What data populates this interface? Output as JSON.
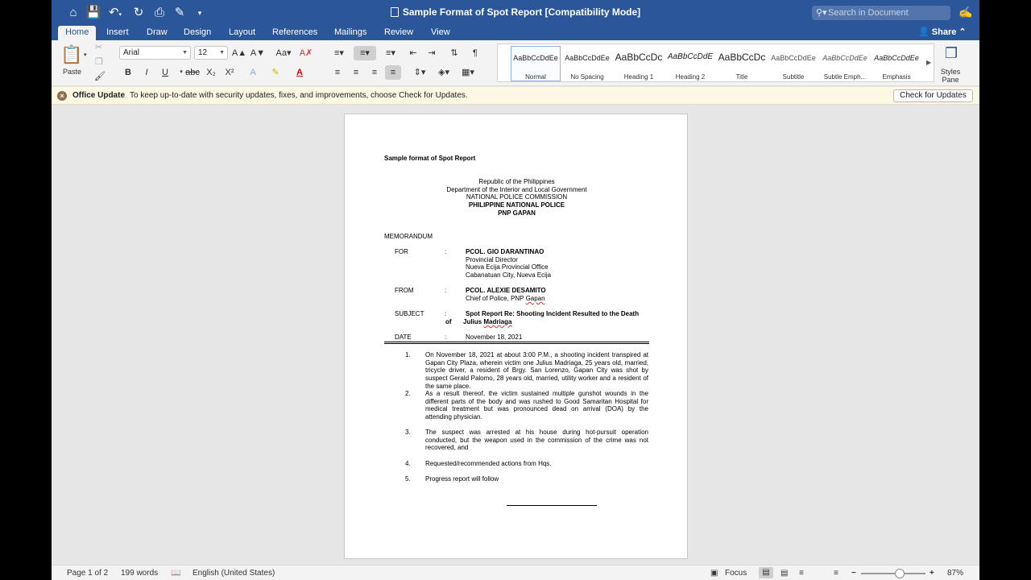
{
  "window": {
    "title": "Sample Format of Spot Report [Compatibility Mode]",
    "search_placeholder": "Search in Document"
  },
  "quick_access": {
    "home_icon": "home-icon",
    "save_icon": "save-icon",
    "undo_icon": "undo-icon",
    "redo_icon": "redo-icon",
    "print_icon": "print-icon"
  },
  "tabs": [
    "Home",
    "Insert",
    "Draw",
    "Design",
    "Layout",
    "References",
    "Mailings",
    "Review",
    "View"
  ],
  "active_tab": "Home",
  "share_label": "Share",
  "ribbon": {
    "paste_label": "Paste",
    "font_name": "Arial",
    "font_size": "12",
    "styles": [
      {
        "preview": "AaBbCcDdEe",
        "name": "Normal"
      },
      {
        "preview": "AaBbCcDdEe",
        "name": "No Spacing"
      },
      {
        "preview": "AaBbCcDc",
        "name": "Heading 1"
      },
      {
        "preview": "AaBbCcDdE",
        "name": "Heading 2"
      },
      {
        "preview": "AaBbCcDc",
        "name": "Title"
      },
      {
        "preview": "AaBbCcDdEe",
        "name": "Subtitle"
      },
      {
        "preview": "AaBbCcDdEe",
        "name": "Subtle Emph..."
      },
      {
        "preview": "AaBbCcDdEe",
        "name": "Emphasis"
      }
    ],
    "styles_pane_label": "Styles Pane"
  },
  "update_bar": {
    "title": "Office Update",
    "message": "To keep up-to-date with security updates, fixes, and improvements, choose Check for Updates.",
    "button": "Check for Updates"
  },
  "document": {
    "heading": "Sample format of Spot Report",
    "letterhead": [
      "Republic of the Philippines",
      "Department of the Interior and Local Government",
      "NATIONAL POLICE COMMISSION",
      "PHILIPPINE NATIONAL POLICE",
      "PNP GAPAN"
    ],
    "memo_label": "MEMORANDUM",
    "for_label": "FOR",
    "for_lines": [
      "PCOL. GIO DARANTINAO",
      "Provincial Director",
      "Nueva Ecija Provincial Office",
      "Cabanatuan City, Nueva Ecija"
    ],
    "from_label": "FROM",
    "from_lines": [
      "PCOL. ALEXIE DESAMITO",
      "Chief of Police, PNP "
    ],
    "from_gapan": "Gapan",
    "subject_label": "SUBJECT",
    "subject_line1": "Spot Report Re: Shooting Incident Resulted to the Death",
    "subject_of": "of",
    "subject_line2a": "Julius ",
    "subject_madriaga": "Madriaga",
    "date_label": "DATE",
    "date_value": "November 18, 2021",
    "colon": ":",
    "items": [
      {
        "num": "1.",
        "text": "On November 18, 2021 at about 3:00 P.M., a shooting incident transpired at Gapan City Plaza, wherein victim one Julius Madriaga, 25 years old, married, tricycle driver, a resident of Brgy. San Lorenzo, Gapan City was shot by suspect Gerald Palomo, 28 years old, married, utility worker and a resident of the same place."
      },
      {
        "num": "2.",
        "text": "As a result thereof, the victim sustained multiple gunshot wounds in the different parts of the body and was rushed to Good Samaritan Hospital for medical treatment but was pronounced dead on arrival (DOA) by the attending physician."
      },
      {
        "num": "3.",
        "text": "The suspect was arrested at his house during hot-pursuit operation conducted, but the weapon used in the commission of the crime was not recovered, and"
      },
      {
        "num": "4.",
        "text": "Requested/recommended actions from Hqs."
      },
      {
        "num": "5.",
        "text": "Progress report will follow"
      }
    ]
  },
  "status_bar": {
    "page": "Page 1 of 2",
    "words": "199 words",
    "language": "English (United States)",
    "focus": "Focus",
    "zoom": "87%",
    "zoom_level": 0.6
  }
}
